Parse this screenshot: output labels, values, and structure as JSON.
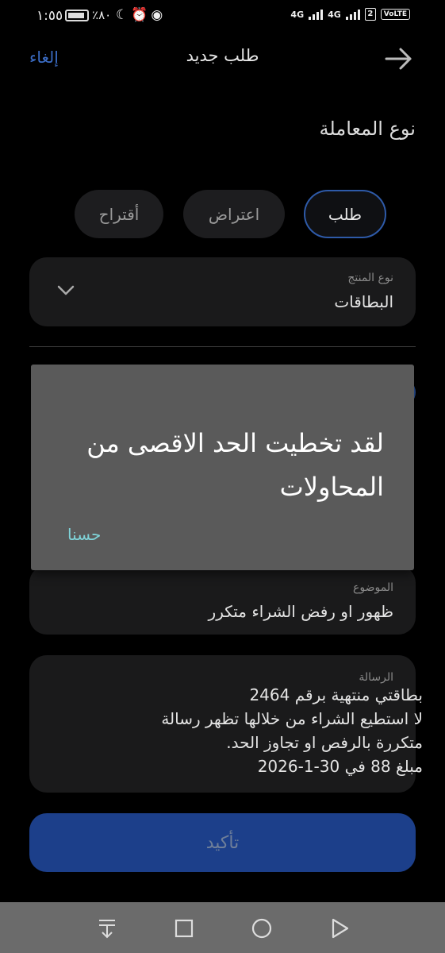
{
  "status_bar": {
    "time": "١:٥٥",
    "battery_percent": "٪٨٠",
    "left_icons": [
      "battery-icon",
      "moon-icon",
      "alarm-icon",
      "eye-icon"
    ],
    "network_1": "4G",
    "network_2": "4G",
    "sim": "2",
    "volte": "VoLTE"
  },
  "header": {
    "cancel_label": "إلغاء",
    "title": "طلب جديد"
  },
  "transaction_type_label": "نوع المعاملة",
  "transaction_types": [
    {
      "label": "طلب",
      "selected": true
    },
    {
      "label": "اعتراض",
      "selected": false
    },
    {
      "label": "أقتراح",
      "selected": false
    }
  ],
  "product": {
    "label": "نوع المنتج",
    "value": "البطاقات"
  },
  "subject": {
    "label": "الموضوع",
    "value": "ظهور او رفض الشراء متكرر"
  },
  "message": {
    "label": "الرسالة",
    "lines": [
      "بطاقتي منتهية برقم 2464",
      "لا استطيع الشراء من خلالها تظهر رسالة",
      "متكررة بالرفص او تجاوز الحد.",
      "مبلغ 88  في 30-1-2026"
    ]
  },
  "confirm_label": "تأكيد",
  "dialog": {
    "message": "لقد تخطيت الحد الاقصى من المحاولات",
    "ok_label": "حسنا"
  },
  "colors": {
    "accent": "#2e5aa8",
    "dialog_bg": "#5a5a5a",
    "dialog_button": "#7fd3d8",
    "confirm_bg": "#1c3f8a"
  }
}
